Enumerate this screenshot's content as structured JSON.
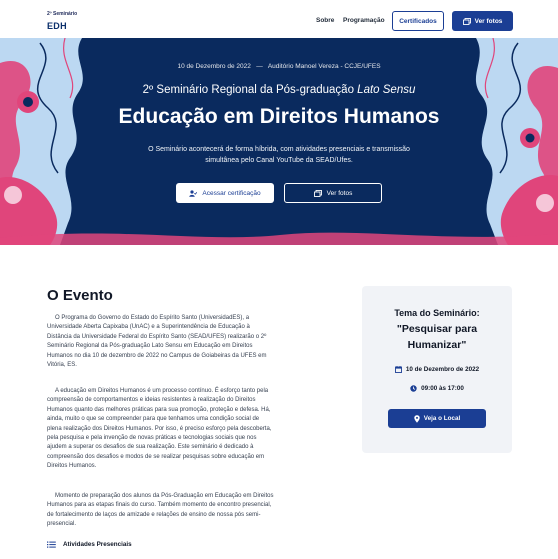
{
  "nav": {
    "brand_sup": "2º Seminário",
    "brand_main": "EDH",
    "links": [
      "Sobre",
      "Programação"
    ],
    "certificates_label": "Certificados",
    "photos_label": "Ver fotos"
  },
  "hero": {
    "date": "10 de Dezembro de 2022",
    "separator": "—",
    "venue": "Auditório Manoel Vereza - CCJE/UFES",
    "subtitle_prefix": "2º Seminário Regional da Pós-graduação ",
    "subtitle_em": "Lato Sensu",
    "title": "Educação em Direitos Humanos",
    "description": "O Seminário acontecerá de forma híbrida, com atividades presenciais e transmissão simultânea pelo Canal YouTube da SEAD/Ufes.",
    "cert_button": "Acessar certificação",
    "photos_button": "Ver fotos",
    "colors": {
      "background": "#0a2a5e",
      "pink": "#e0457b",
      "light_blue": "#bcd8f2"
    }
  },
  "event": {
    "title": "O Evento",
    "paragraphs": [
      "O Programa do Governo do Estado do Espírito Santo (UniversidadES), a Universidade Aberta Capixaba (UnAC) e a Superintendência de Educação à Distância da Universidade Federal do Espírito Santo (SEAD/UFES) realizarão o 2º Seminário Regional da Pós-graduação Lato Sensu em Educação em Direitos Humanos no dia 10 de dezembro de 2022 no Campus de Goiabeiras da UFES em Vitória, ES.",
      "A educação em Direitos Humanos é um processo contínuo. É esforço tanto pela compreensão de comportamentos e ideias resistentes à realização do Direitos Humanos quanto das melhores práticas para sua promoção, proteção e defesa. Há, ainda, muito o que se compreender para que tenhamos uma condição social de plena realização dos Direitos Humanos. Por isso, é preciso esforço pela descoberta, pela pesquisa e pela invenção de novas práticas e tecnologias sociais que nos ajudem a superar os desafios de sua realização. Este seminário é dedicado à compreensão dos desafios e modos de se realizar pesquisas sobre educação em Direitos Humanos.",
      "Momento de preparação dos alunos da Pós-Graduação em Educação em Direitos Humanos para as etapas finais do curso. Também momento de encontro presencial, de fortalecimento de laços de amizade e relações de ensino de nossa pós semi-presencial."
    ],
    "activities_label": "Atividades Presenciais"
  },
  "card": {
    "label": "Tema do Seminário:",
    "theme": "\"Pesquisar para Humanizar\"",
    "date": "10 de Dezembro de 2022",
    "time": "09:00 às 17:00",
    "location_button": "Veja o Local"
  },
  "icons": [
    "images-icon",
    "user-check-icon",
    "calendar-icon",
    "clock-icon",
    "map-pin-icon",
    "list-icon"
  ]
}
